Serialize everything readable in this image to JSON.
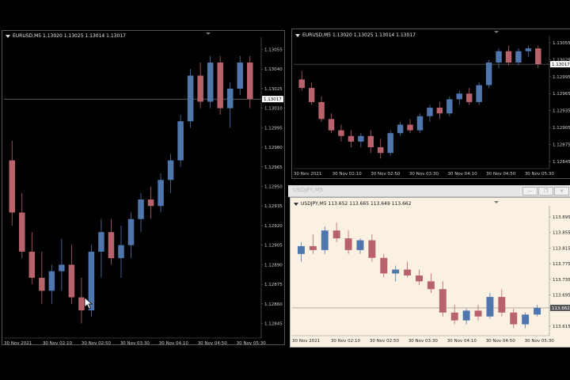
{
  "colors": {
    "up": "#4f76ad",
    "down": "#b8636c",
    "dark_bg": "#000000",
    "light_bg": "#fbf1e3"
  },
  "charts": [
    {
      "id": "left",
      "header": "EURUSD,M5  1.13020 1.13025 1.13014 1.13017",
      "current_price": "1.13017",
      "theme": "dark",
      "y_ticks": [
        "1.13055",
        "1.13040",
        "1.13025",
        "1.13010",
        "1.12995",
        "1.12980",
        "1.12965",
        "1.12950",
        "1.12935",
        "1.12920",
        "1.12905",
        "1.12890",
        "1.12875",
        "1.12860",
        "1.12845"
      ],
      "x_ticks": [
        "30 Nov 2021",
        "30 Nov 02:10",
        "30 Nov 02:50",
        "30 Nov 03:30",
        "30 Nov 04:10",
        "30 Nov 04:50",
        "30 Nov 05:30"
      ],
      "y_range": [
        1.12835,
        1.13062
      ],
      "chart_data": {
        "type": "candlestick",
        "symbol": "EURUSD,M5",
        "ohlc": [
          [
            1.1297,
            1.12985,
            1.1292,
            1.1293
          ],
          [
            1.1293,
            1.12945,
            1.12895,
            1.129
          ],
          [
            1.129,
            1.12915,
            1.12875,
            1.1288
          ],
          [
            1.1288,
            1.129,
            1.1286,
            1.1287
          ],
          [
            1.1287,
            1.1289,
            1.1286,
            1.12885
          ],
          [
            1.12885,
            1.1291,
            1.1287,
            1.1289
          ],
          [
            1.1289,
            1.12905,
            1.1286,
            1.12865
          ],
          [
            1.12865,
            1.1288,
            1.12845,
            1.12855
          ],
          [
            1.12855,
            1.12905,
            1.1285,
            1.129
          ],
          [
            1.129,
            1.12925,
            1.1288,
            1.12915
          ],
          [
            1.12915,
            1.12925,
            1.1289,
            1.12895
          ],
          [
            1.12895,
            1.1292,
            1.1288,
            1.12905
          ],
          [
            1.12905,
            1.1293,
            1.12895,
            1.12925
          ],
          [
            1.12925,
            1.12945,
            1.12915,
            1.1294
          ],
          [
            1.1294,
            1.1295,
            1.12925,
            1.12935
          ],
          [
            1.12935,
            1.1296,
            1.1293,
            1.12955
          ],
          [
            1.12955,
            1.12975,
            1.12945,
            1.1297
          ],
          [
            1.1297,
            1.13005,
            1.12965,
            1.13
          ],
          [
            1.13,
            1.1304,
            1.12995,
            1.13035
          ],
          [
            1.13035,
            1.13045,
            1.1301,
            1.13015
          ],
          [
            1.13015,
            1.1305,
            1.1301,
            1.13045
          ],
          [
            1.13045,
            1.1305,
            1.13005,
            1.1301
          ],
          [
            1.1301,
            1.1303,
            1.12995,
            1.13025
          ],
          [
            1.13025,
            1.1305,
            1.1302,
            1.13045
          ],
          [
            1.13045,
            1.1305,
            1.1301,
            1.13017
          ]
        ]
      }
    },
    {
      "id": "top-right",
      "header": "EURUSD,M5  1.13020 1.13025 1.13014 1.13017",
      "current_price": "1.13017",
      "theme": "dark",
      "y_ticks": [
        "1.13055",
        "1.13025",
        "1.12995",
        "1.12965",
        "1.12935",
        "1.12905",
        "1.12875",
        "1.12845"
      ],
      "x_ticks": [
        "30 Nov 2021",
        "30 Nov 02:10",
        "30 Nov 02:50",
        "30 Nov 03:30",
        "30 Nov 04:10",
        "30 Nov 04:50",
        "30 Nov 05:30"
      ],
      "y_range": [
        1.12835,
        1.13062
      ],
      "chart_data": {
        "type": "candlestick",
        "symbol": "EURUSD,M5",
        "ohlc": [
          [
            1.1299,
            1.13005,
            1.1297,
            1.12975
          ],
          [
            1.12975,
            1.12985,
            1.12945,
            1.1295
          ],
          [
            1.1295,
            1.1296,
            1.12915,
            1.1292
          ],
          [
            1.1292,
            1.1293,
            1.12895,
            1.129
          ],
          [
            1.129,
            1.1291,
            1.1288,
            1.1289
          ],
          [
            1.1289,
            1.129,
            1.1287,
            1.1288
          ],
          [
            1.1288,
            1.12895,
            1.1287,
            1.1289
          ],
          [
            1.1289,
            1.129,
            1.1286,
            1.1287
          ],
          [
            1.1287,
            1.12885,
            1.1285,
            1.1286
          ],
          [
            1.1286,
            1.129,
            1.12855,
            1.12895
          ],
          [
            1.12895,
            1.12915,
            1.1289,
            1.1291
          ],
          [
            1.1291,
            1.1292,
            1.12895,
            1.129
          ],
          [
            1.129,
            1.1293,
            1.12895,
            1.12925
          ],
          [
            1.12925,
            1.12945,
            1.12915,
            1.1294
          ],
          [
            1.1294,
            1.1295,
            1.1292,
            1.1293
          ],
          [
            1.1293,
            1.1296,
            1.12925,
            1.12955
          ],
          [
            1.12955,
            1.1297,
            1.12945,
            1.12965
          ],
          [
            1.12965,
            1.12975,
            1.12945,
            1.1295
          ],
          [
            1.1295,
            1.12985,
            1.12945,
            1.1298
          ],
          [
            1.1298,
            1.13025,
            1.12975,
            1.1302
          ],
          [
            1.1302,
            1.13045,
            1.1301,
            1.1304
          ],
          [
            1.1304,
            1.1305,
            1.13015,
            1.1302
          ],
          [
            1.1302,
            1.13045,
            1.13015,
            1.1304
          ],
          [
            1.1304,
            1.1305,
            1.1303,
            1.13045
          ],
          [
            1.13045,
            1.1305,
            1.1301,
            1.13017
          ]
        ]
      }
    },
    {
      "id": "bottom-right",
      "header": "USDJPY,M5  113.652 113.665 113.649 113.662",
      "current_price": "113.662",
      "theme": "light",
      "y_ticks": [
        "113.895",
        "113.855",
        "113.815",
        "113.775",
        "113.735",
        "113.695",
        "113.662",
        "113.615"
      ],
      "x_ticks": [
        "30 Nov 2021",
        "30 Nov 02:10",
        "30 Nov 02:50",
        "30 Nov 03:30",
        "30 Nov 04:10",
        "30 Nov 04:50",
        "30 Nov 05:30"
      ],
      "y_range": [
        113.595,
        113.915
      ],
      "chart_data": {
        "type": "candlestick",
        "symbol": "USDJPY,M5",
        "ohlc": [
          [
            113.8,
            113.83,
            113.78,
            113.82
          ],
          [
            113.82,
            113.85,
            113.8,
            113.81
          ],
          [
            113.81,
            113.87,
            113.8,
            113.86
          ],
          [
            113.86,
            113.88,
            113.83,
            113.84
          ],
          [
            113.84,
            113.86,
            113.8,
            113.81
          ],
          [
            113.81,
            113.84,
            113.8,
            113.835
          ],
          [
            113.835,
            113.85,
            113.78,
            113.79
          ],
          [
            113.79,
            113.8,
            113.74,
            113.75
          ],
          [
            113.75,
            113.77,
            113.73,
            113.76
          ],
          [
            113.76,
            113.78,
            113.74,
            113.745
          ],
          [
            113.745,
            113.76,
            113.72,
            113.73
          ],
          [
            113.73,
            113.75,
            113.7,
            113.71
          ],
          [
            113.71,
            113.73,
            113.64,
            113.65
          ],
          [
            113.65,
            113.67,
            113.62,
            113.63
          ],
          [
            113.63,
            113.66,
            113.62,
            113.655
          ],
          [
            113.655,
            113.67,
            113.63,
            113.64
          ],
          [
            113.64,
            113.7,
            113.635,
            113.69
          ],
          [
            113.69,
            113.71,
            113.64,
            113.65
          ],
          [
            113.65,
            113.66,
            113.61,
            113.62
          ],
          [
            113.62,
            113.65,
            113.61,
            113.645
          ],
          [
            113.645,
            113.67,
            113.64,
            113.662
          ]
        ]
      }
    }
  ],
  "inactive_window": {
    "title": "USDJPY,M5",
    "buttons": [
      "—",
      "❐",
      "✕"
    ]
  }
}
